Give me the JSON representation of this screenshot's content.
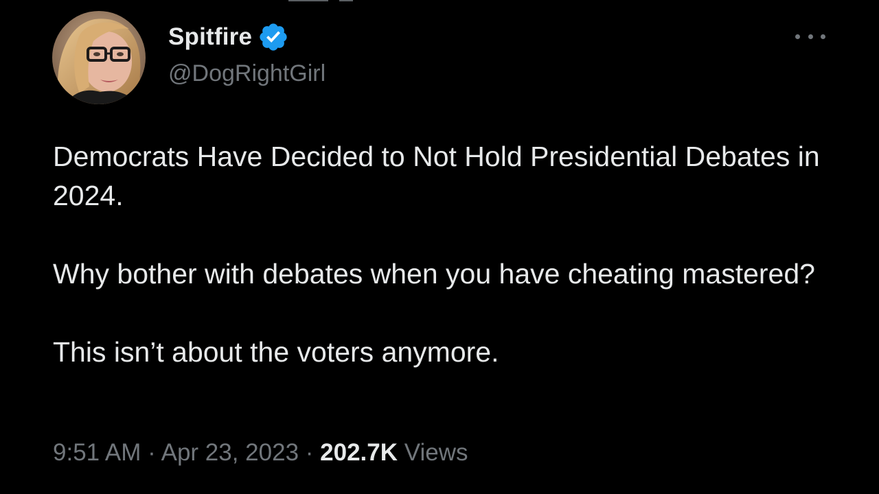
{
  "author": {
    "display_name": "Spitfire",
    "handle": "@DogRightGirl",
    "verified": true,
    "avatar_icon": "profile-photo-woman-glasses"
  },
  "tweet": {
    "paragraphs": [
      "Democrats Have Decided to Not Hold Presidential Debates in 2024.",
      "Why bother with debates when you have cheating mastered?",
      "This isn’t about the voters anymore."
    ]
  },
  "meta": {
    "time": "9:51 AM",
    "separator": " · ",
    "date": "Apr 23, 2023",
    "views_count": "202.7K",
    "views_label": "Views"
  },
  "icons": {
    "more": "more-options-icon",
    "verified": "verified-badge-icon"
  },
  "colors": {
    "background": "#000000",
    "text_primary": "#e7e9ea",
    "text_secondary": "#71767b",
    "verified_blue": "#1d9bf0"
  }
}
